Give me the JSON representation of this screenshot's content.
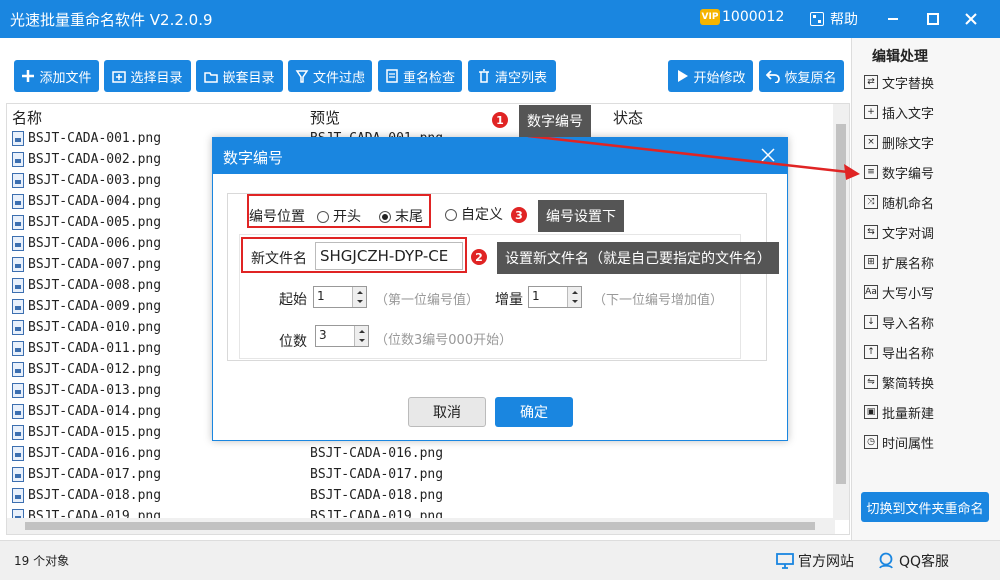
{
  "window": {
    "title": "光速批量重命名软件 V2.2.0.9",
    "vip_label": "VIP",
    "account": "1000012",
    "help": "帮助"
  },
  "toolbar": {
    "add_file": "添加文件",
    "select_dir": "选择目录",
    "nested_dir": "嵌套目录",
    "file_filter": "文件过虑",
    "rename_check": "重名检查",
    "clear_list": "清空列表",
    "start": "开始修改",
    "restore": "恢复原名"
  },
  "list": {
    "headers": {
      "name": "名称",
      "preview": "预览",
      "status": "状态"
    },
    "rows": [
      {
        "name": "BSJT-CADA-001.png",
        "preview": "BSJT-CADA-001.png"
      },
      {
        "name": "BSJT-CADA-002.png",
        "preview": ""
      },
      {
        "name": "BSJT-CADA-003.png",
        "preview": ""
      },
      {
        "name": "BSJT-CADA-004.png",
        "preview": ""
      },
      {
        "name": "BSJT-CADA-005.png",
        "preview": ""
      },
      {
        "name": "BSJT-CADA-006.png",
        "preview": ""
      },
      {
        "name": "BSJT-CADA-007.png",
        "preview": ""
      },
      {
        "name": "BSJT-CADA-008.png",
        "preview": ""
      },
      {
        "name": "BSJT-CADA-009.png",
        "preview": ""
      },
      {
        "name": "BSJT-CADA-010.png",
        "preview": ""
      },
      {
        "name": "BSJT-CADA-011.png",
        "preview": ""
      },
      {
        "name": "BSJT-CADA-012.png",
        "preview": ""
      },
      {
        "name": "BSJT-CADA-013.png",
        "preview": ""
      },
      {
        "name": "BSJT-CADA-014.png",
        "preview": ""
      },
      {
        "name": "BSJT-CADA-015.png",
        "preview": ""
      },
      {
        "name": "BSJT-CADA-016.png",
        "preview": "BSJT-CADA-016.png"
      },
      {
        "name": "BSJT-CADA-017.png",
        "preview": "BSJT-CADA-017.png"
      },
      {
        "name": "BSJT-CADA-018.png",
        "preview": "BSJT-CADA-018.png"
      },
      {
        "name": "BSJT-CADA-019.png",
        "preview": "BSJT-CADA-019.png"
      }
    ]
  },
  "panel": {
    "title": "编辑处理",
    "items": [
      "文字替换",
      "插入文字",
      "删除文字",
      "数字编号",
      "随机命名",
      "文字对调",
      "扩展名称",
      "大写小写",
      "导入名称",
      "导出名称",
      "繁简转换",
      "批量新建",
      "时间属性"
    ],
    "switch_button": "切换到文件夹重命名"
  },
  "status": {
    "count": "19 个对象",
    "website": "官方网站",
    "qq": "QQ客服"
  },
  "dialog": {
    "title": "数字编号",
    "position_label": "编号位置",
    "opt_start": "开头",
    "opt_end": "末尾",
    "opt_custom": "自定义",
    "selected": "末尾",
    "filename_label": "新文件名",
    "filename_value": "SHGJCZH-DYP-CE",
    "start_label": "起始",
    "start_value": "1",
    "start_hint": "（第一位编号值）",
    "step_label": "增量",
    "step_value": "1",
    "step_hint": "（下一位编号增加值）",
    "digits_label": "位数",
    "digits_value": "3",
    "digits_hint": "（位数3编号000开始）",
    "cancel": "取消",
    "ok": "确定"
  },
  "annotations": [
    {
      "num": "1",
      "text": "数字编号"
    },
    {
      "num": "2",
      "text": "设置新文件名（就是自己要指定的文件名）"
    },
    {
      "num": "3",
      "text": "编号设置下"
    }
  ],
  "colors": {
    "primary": "#1a86e0",
    "highlight": "#e02424",
    "callout": "#555555"
  }
}
